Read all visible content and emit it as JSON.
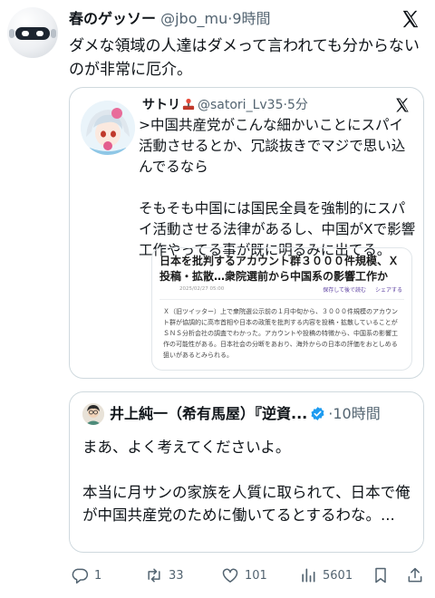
{
  "tweet": {
    "display_name": "春のゲッソー",
    "handle": "@jbo_mu",
    "separator": "·",
    "time": "9時間",
    "text": "ダメな領域の人達はダメって言われても分からないのが非常に厄介。"
  },
  "quote": {
    "display_name": "サトリ",
    "handle": "@satori_Lv35",
    "separator": "·",
    "time": "5分",
    "text": ">中国共産党がこんな細かいことにスパイ活動させるとか、冗談抜きでマジで思い込んでるなら\n\nそもそも中国には国民全員を強制的にスパイ活動させる法律があるし、中国がXで影響工作やってる事が既に明るみに出てる。",
    "article": {
      "title": "日本を批判するアカウント群３０００件規模、Ｘ投稿・拡散…衆院選前から中国系の影響工作か",
      "date": "2025/02/27 05:00",
      "save_label": "保存して後で読む",
      "share_label": "シェアする",
      "body": "Ｘ（旧ツイッター）上で衆院選公示前の１月中旬から、３０００件規模のアカウント群が協調的に高市首相や日本の政策を批判する内容を投稿・拡散していることがＳＮＳ分析会社の調査でわかった。アカウントや投稿の特徴から、中国系の影響工作の可能性がある。日本社会の分断をあおり、海外からの日本の評価をおとしめる狙いがあるとみられる。"
    }
  },
  "reply": {
    "display_name": "井上純一（希有馬屋）『逆資...",
    "separator": "·",
    "time": "10時間",
    "text": "まあ、よく考えてくださいよ。\n\n本当に月サンの家族を人質に取られて、日本で俺が中国共産党のために働いてるとするわな。..."
  },
  "actions": {
    "replies": "1",
    "retweets": "33",
    "likes": "101",
    "views": "5601"
  },
  "icons": {
    "verified": "verified-badge-icon",
    "joystick": "joystick-icon",
    "x_logo": "x-logo-icon"
  },
  "colors": {
    "text": "#0f1419",
    "muted": "#536471",
    "border": "#cfd9de",
    "verified": "#1d9bf0"
  }
}
